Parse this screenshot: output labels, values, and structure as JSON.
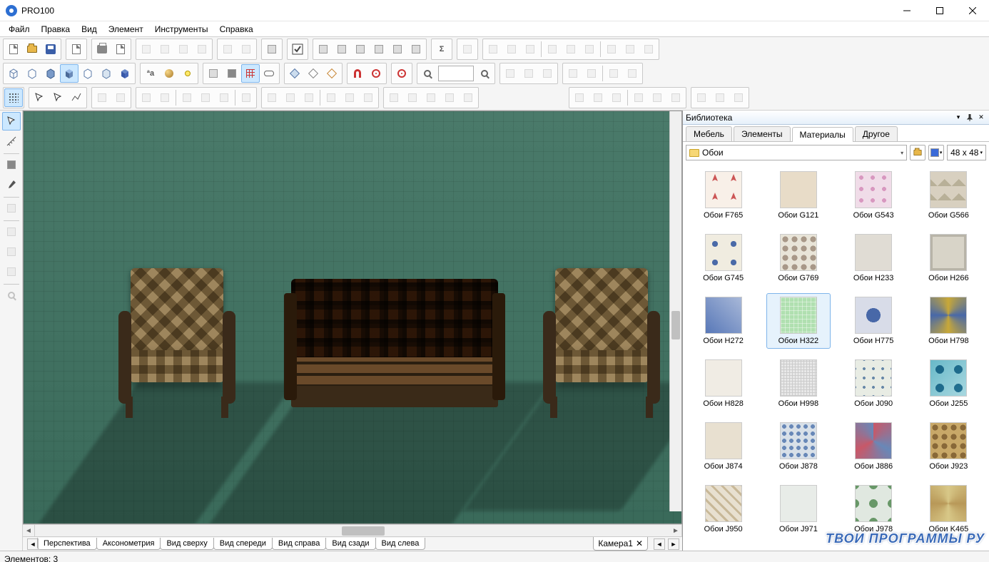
{
  "app": {
    "title": "PRO100"
  },
  "menu": [
    "Файл",
    "Правка",
    "Вид",
    "Элемент",
    "Инструменты",
    "Справка"
  ],
  "viewtabs": [
    "Перспектива",
    "Аксонометрия",
    "Вид сверху",
    "Вид спереди",
    "Вид справа",
    "Вид сзади",
    "Вид слева"
  ],
  "camera_tab": "Камера1",
  "library": {
    "title": "Библиотека",
    "tabs": [
      "Мебель",
      "Элементы",
      "Материалы",
      "Другое"
    ],
    "active_tab": 2,
    "path": "Обои",
    "thumbsize": "48 x  48",
    "items": [
      {
        "name": "Обои F765",
        "sw": "sw-f765"
      },
      {
        "name": "Обои G121",
        "sw": "sw-g121"
      },
      {
        "name": "Обои G543",
        "sw": "sw-g543"
      },
      {
        "name": "Обои G566",
        "sw": "sw-g566"
      },
      {
        "name": "Обои G745",
        "sw": "sw-g745"
      },
      {
        "name": "Обои G769",
        "sw": "sw-g769"
      },
      {
        "name": "Обои H233",
        "sw": "sw-h233"
      },
      {
        "name": "Обои H266",
        "sw": "sw-h266"
      },
      {
        "name": "Обои H272",
        "sw": "sw-h272"
      },
      {
        "name": "Обои H322",
        "sw": "sw-h322",
        "selected": true
      },
      {
        "name": "Обои H775",
        "sw": "sw-h775"
      },
      {
        "name": "Обои H798",
        "sw": "sw-h798"
      },
      {
        "name": "Обои H828",
        "sw": "sw-h828"
      },
      {
        "name": "Обои H998",
        "sw": "sw-h998"
      },
      {
        "name": "Обои J090",
        "sw": "sw-j090"
      },
      {
        "name": "Обои J255",
        "sw": "sw-j255"
      },
      {
        "name": "Обои J874",
        "sw": "sw-j874"
      },
      {
        "name": "Обои J878",
        "sw": "sw-j878"
      },
      {
        "name": "Обои J886",
        "sw": "sw-j886"
      },
      {
        "name": "Обои J923",
        "sw": "sw-j923"
      },
      {
        "name": "Обои J950",
        "sw": "sw-j950"
      },
      {
        "name": "Обои J971",
        "sw": "sw-j971"
      },
      {
        "name": "Обои J978",
        "sw": "sw-j978"
      },
      {
        "name": "Обои K465",
        "sw": "sw-k465"
      }
    ]
  },
  "status": {
    "elements_label": "Элементов:",
    "elements_count": "3"
  },
  "watermark": "ТВОИ ПРОГРАММЫ РУ",
  "zoom_value": ""
}
